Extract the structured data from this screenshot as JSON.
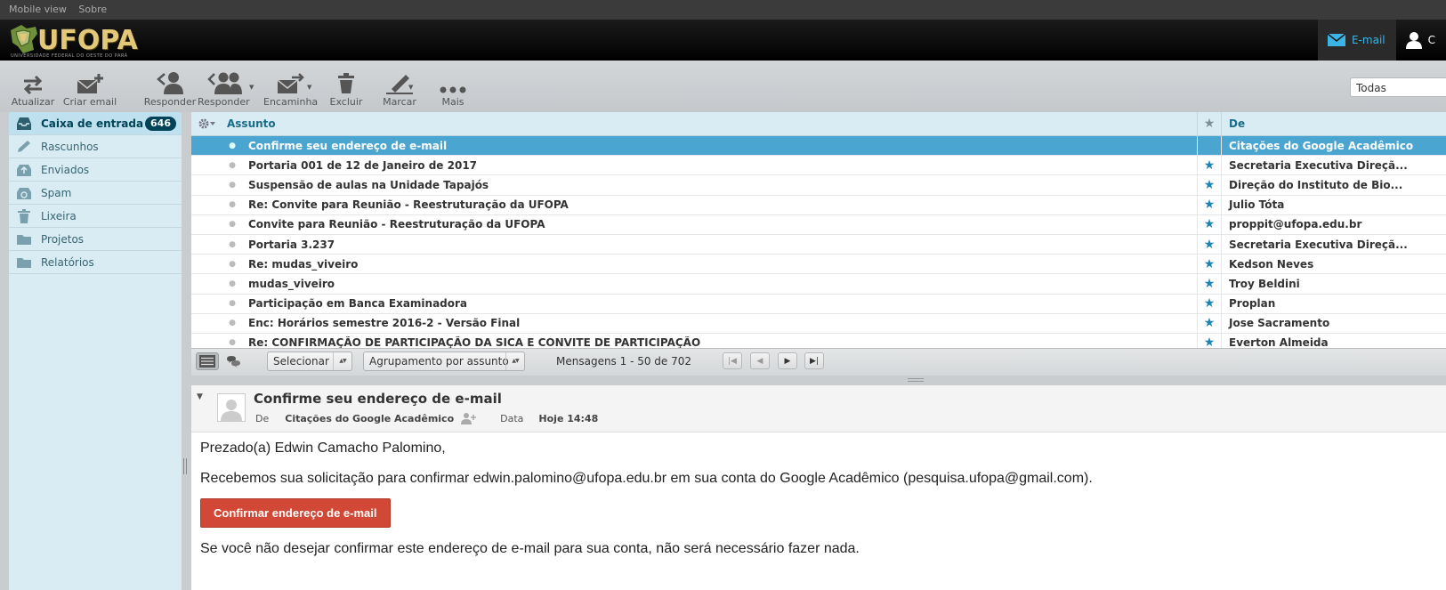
{
  "topline": {
    "mobile_view": "Mobile view",
    "about": "Sobre"
  },
  "header": {
    "logo_text": "UFOPA",
    "logo_tagline": "UNIVERSIDADE FEDERAL DO OESTE DO PARÁ",
    "tasks": [
      {
        "label": "E-mail",
        "icon": "envelope-icon",
        "selected": true
      },
      {
        "label": "C",
        "icon": "user-icon",
        "selected": false
      }
    ]
  },
  "toolbar": {
    "refresh": "Atualizar",
    "compose": "Criar email",
    "reply": "Responder",
    "reply_all": "Responder ...",
    "forward": "Encaminhar",
    "delete": "Excluir",
    "mark": "Marcar",
    "more": "Mais",
    "filter_value": "Todas"
  },
  "folders": [
    {
      "label": "Caixa de entrada",
      "icon": "inbox-icon",
      "unread": "646",
      "selected": true
    },
    {
      "label": "Rascunhos",
      "icon": "pencil-icon"
    },
    {
      "label": "Enviados",
      "icon": "sent-icon"
    },
    {
      "label": "Spam",
      "icon": "spam-icon"
    },
    {
      "label": "Lixeira",
      "icon": "trash-icon"
    },
    {
      "label": "Projetos",
      "icon": "folder-icon"
    },
    {
      "label": "Relatórios",
      "icon": "folder-icon"
    }
  ],
  "messagelist": {
    "col_subject": "Assunto",
    "col_from": "De",
    "flag_color": "#1d83b4",
    "messages": [
      {
        "subject": "Confirme seu endereço de e-mail",
        "from": "Citações do Google Acadêmico",
        "flagged": false,
        "selected": true
      },
      {
        "subject": "Portaria 001 de 12 de Janeiro de 2017",
        "from": "Secretaria Executiva Direçã...",
        "flagged": true
      },
      {
        "subject": "Suspensão de aulas na Unidade Tapajós",
        "from": "Direção do Instituto de Bio...",
        "flagged": true
      },
      {
        "subject": "Re: Convite para Reunião - Reestruturação da UFOPA",
        "from": "Julio Tóta",
        "flagged": true
      },
      {
        "subject": "Convite para Reunião - Reestruturação da UFOPA",
        "from": "proppit@ufopa.edu.br",
        "flagged": true
      },
      {
        "subject": "Portaria 3.237",
        "from": "Secretaria Executiva Direçã...",
        "flagged": true
      },
      {
        "subject": "Re: mudas_viveiro",
        "from": "Kedson Neves",
        "flagged": true
      },
      {
        "subject": "mudas_viveiro",
        "from": "Troy Beldini",
        "flagged": true
      },
      {
        "subject": "Participação em Banca Examinadora",
        "from": "Proplan",
        "flagged": true
      },
      {
        "subject": "Enc: Horários semestre 2016-2 - Versão Final",
        "from": "Jose Sacramento",
        "flagged": true
      },
      {
        "subject": "Re: CONFIRMAÇÃO DE PARTICIPAÇÃO DA SICA E CONVITE DE PARTICIPAÇÃO",
        "from": "Everton Almeida",
        "flagged": true
      }
    ]
  },
  "listfooter": {
    "select_label": "Selecionar",
    "threads_label": "Agrupamento por assunto",
    "count_text": "Mensagens 1 - 50 de 702"
  },
  "preview": {
    "subject": "Confirme seu endereço de e-mail",
    "from_label": "De",
    "from_value": "Citações do Google Acadêmico",
    "date_label": "Data",
    "date_value": "Hoje 14:48",
    "greeting": "Prezado(a) Edwin Camacho Palomino,",
    "paragraph1": "Recebemos sua solicitação para confirmar edwin.palomino@ufopa.edu.br em sua conta do Google Acadêmico (pesquisa.ufopa@gmail.com).",
    "button_label": "Confirmar endereço de e-mail",
    "paragraph2": "Se você não desejar confirmar este endereço de e-mail para sua conta, não será necessário fazer nada.",
    "button_color": "#d14836"
  }
}
